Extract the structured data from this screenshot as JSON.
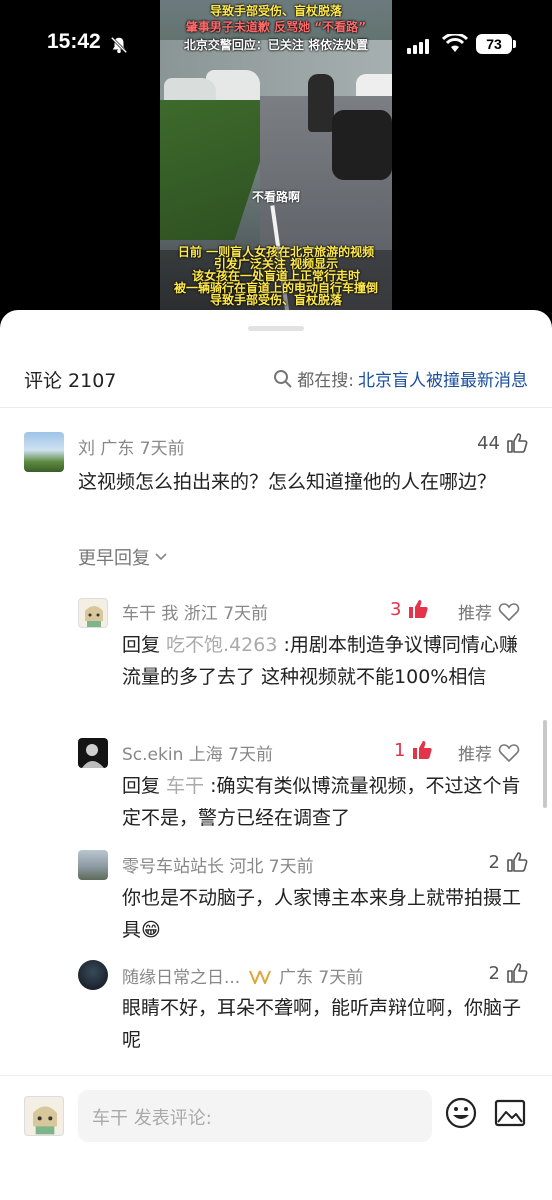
{
  "status_bar": {
    "time": "15:42",
    "battery": "73"
  },
  "video": {
    "caption_top_1": "导致手部受伤、盲杖脱落",
    "caption_top_2": "肇事男子未道歉 反骂她 “不看路”",
    "caption_top_3": "北京交警回应：已关注 将依法处置",
    "mid_text": "不看路啊",
    "caption_bottom": [
      "日前 一则盲人女孩在北京旅游的视频",
      "引发广泛关注 视频显示",
      "该女孩在一处盲道上正常行走时",
      "被一辆骑行在盲道上的电动自行车撞倒",
      "导致手部受伤、盲杖脱落"
    ]
  },
  "header": {
    "title": "评论 2107",
    "search_prefix": "都在搜:",
    "search_query": "北京盲人被撞最新消息"
  },
  "comments": {
    "main": {
      "user": "刘 广东 7天前",
      "likes": "44",
      "text": "这视频怎么拍出来的？怎么知道撞他的人在哪边？",
      "more_replies": "更早回复"
    },
    "replies": [
      {
        "user": "车干 我 浙江 7天前",
        "likes": "3",
        "recommend": "推荐",
        "reply_prefix": "回复 ",
        "reply_to": "吃不饱.4263",
        "text": " :用剧本制造争议博同情心赚流量的多了去了  这种视频就不能100%相信"
      },
      {
        "user": "Sc.ekin 上海 7天前",
        "likes": "1",
        "recommend": "推荐",
        "reply_prefix": "回复 ",
        "reply_to": "车干",
        "text": " :确实有类似博流量视频，不过这个肯定不是，警方已经在调查了"
      },
      {
        "user": "零号车站站长 河北 7天前",
        "likes": "2",
        "text": "你也是不动脑子，人家博主本来身上就带拍摄工具😁"
      },
      {
        "user": "随缘日常之日...",
        "user_suffix": "广东 7天前",
        "likes": "2",
        "text": "眼睛不好，耳朵不聋啊，能听声辩位啊，你脑子呢"
      }
    ]
  },
  "input": {
    "placeholder": "车干 发表评论:"
  },
  "colors": {
    "accent_blue": "#1a4f9e",
    "like_red": "#e3344a"
  }
}
